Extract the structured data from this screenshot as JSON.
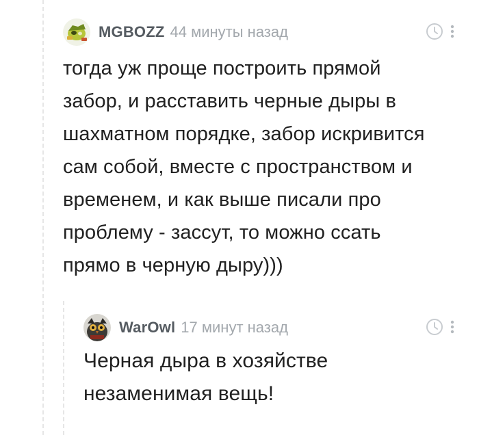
{
  "comments": [
    {
      "author": "MGBOZZ",
      "time": "44 минуты назад",
      "avatar_icon": "toy-figure-avatar",
      "text_lines": [
        "тогда уж проще построить прямой",
        "забор, и расставить черные дыры в",
        "шахматном порядке, забор искривится",
        "сам собой, вместе с пространством и",
        "временем, и как выше писали про",
        "проблему - зассут, то можно ссать",
        "прямо в черную дыру)))"
      ]
    },
    {
      "author": "WarOwl",
      "time": "17 минут назад",
      "avatar_icon": "owl-avatar",
      "text_lines": [
        "Черная дыра в хозяйстве",
        "незаменимая вещь!"
      ]
    }
  ],
  "colors": {
    "author": "#555b61",
    "time": "#a3a8ad",
    "text": "#212121",
    "thread_line": "#e6e6e6",
    "icon": "#c8ccd0"
  }
}
